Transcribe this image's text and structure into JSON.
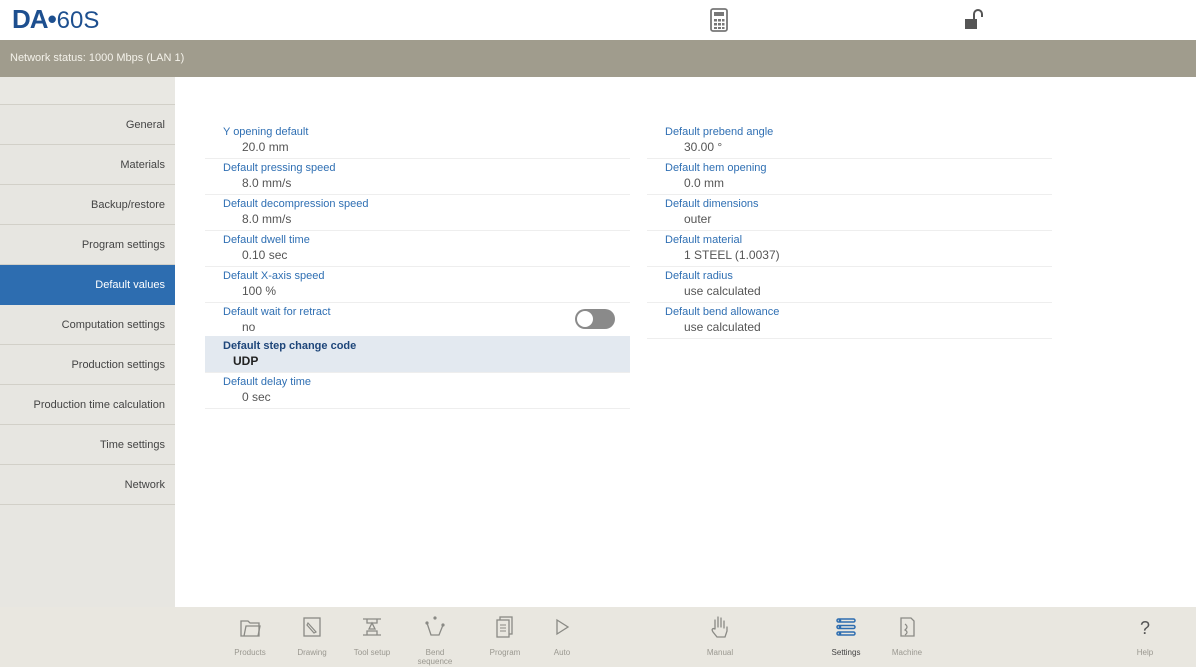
{
  "app": {
    "logo_brand": "DA",
    "logo_dot": "•",
    "logo_model": "60S"
  },
  "status": {
    "text": "Network status: 1000 Mbps (LAN 1)"
  },
  "sidebar": {
    "items": [
      {
        "label": "General"
      },
      {
        "label": "Materials"
      },
      {
        "label": "Backup/restore"
      },
      {
        "label": "Program settings"
      },
      {
        "label": "Default values",
        "active": true
      },
      {
        "label": "Computation settings"
      },
      {
        "label": "Production settings"
      },
      {
        "label": "Production time calculation"
      },
      {
        "label": "Time settings"
      },
      {
        "label": "Network"
      }
    ]
  },
  "params": {
    "left": [
      {
        "label": "Y opening default",
        "value": "20.0 mm"
      },
      {
        "label": "Default pressing speed",
        "value": "8.0 mm/s"
      },
      {
        "label": "Default decompression speed",
        "value": "8.0 mm/s"
      },
      {
        "label": "Default dwell time",
        "value": "0.10 sec"
      },
      {
        "label": "Default X-axis speed",
        "value": "100 %"
      },
      {
        "label": "Default wait for retract",
        "value": "no",
        "toggle": "off"
      },
      {
        "label": "Default step change code",
        "value": "UDP",
        "selected": true
      },
      {
        "label": "Default delay time",
        "value": "0 sec"
      }
    ],
    "right": [
      {
        "label": "Default prebend angle",
        "value": "30.00 °"
      },
      {
        "label": "Default hem opening",
        "value": "0.0 mm"
      },
      {
        "label": "Default dimensions",
        "value": "outer"
      },
      {
        "label": "Default material",
        "value": "1 STEEL (1.0037)"
      },
      {
        "label": "Default radius",
        "value": "use calculated"
      },
      {
        "label": "Default bend allowance",
        "value": "use calculated"
      }
    ]
  },
  "bottom_tabs": [
    {
      "label": "Products",
      "icon": "folder-icon"
    },
    {
      "label": "Drawing",
      "icon": "pencil-icon"
    },
    {
      "label": "Tool setup",
      "icon": "tool-setup-icon"
    },
    {
      "label": "Bend sequence",
      "icon": "bend-sequence-icon"
    },
    {
      "label": "Program",
      "icon": "program-icon"
    },
    {
      "label": "Auto",
      "icon": "play-icon"
    },
    {
      "label": "Manual",
      "icon": "hand-icon"
    },
    {
      "label": "Settings",
      "icon": "settings-list-icon",
      "active": true
    },
    {
      "label": "Machine",
      "icon": "machine-icon"
    },
    {
      "label": "Help",
      "icon": "help-icon"
    }
  ],
  "colors": {
    "accent": "#2d6db0",
    "status_bar": "#a09c8d",
    "label_blue": "#2f6fb3",
    "selected_row": "#e3e9f0"
  }
}
